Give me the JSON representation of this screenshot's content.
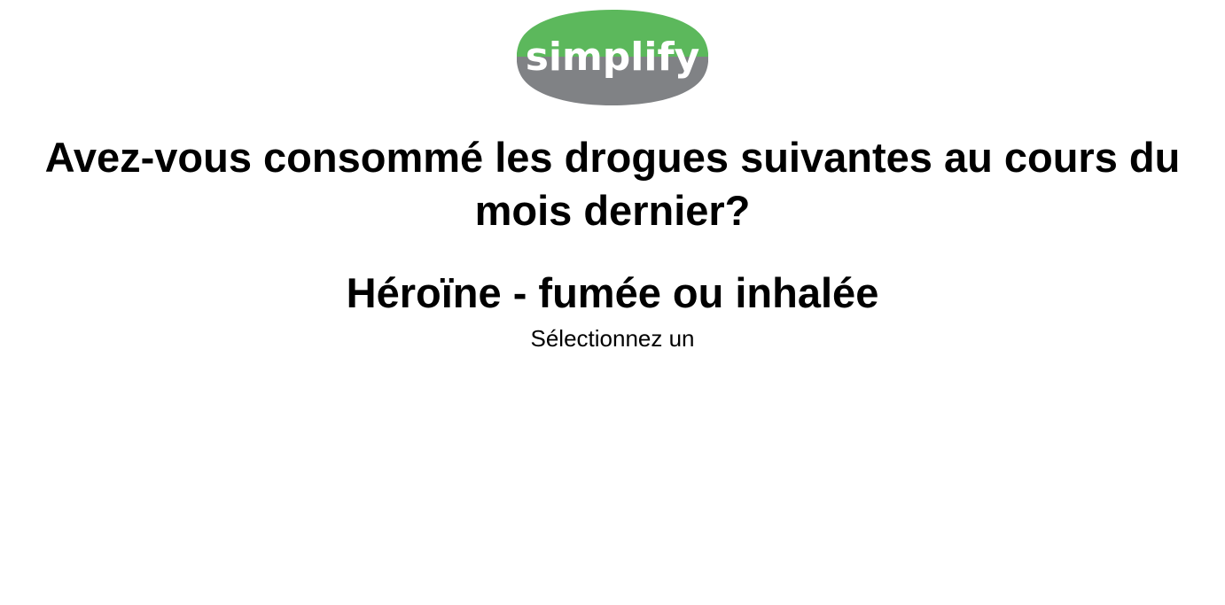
{
  "logo": {
    "text": "simplify",
    "colors": {
      "top": "#5cb85c",
      "bottom": "#808285",
      "text": "#ffffff"
    }
  },
  "survey": {
    "question": "Avez-vous consommé les drogues suivantes au cours du mois dernier?",
    "drug_name": "Héroïne - fumée ou inhalée",
    "instruction": "Sélectionnez un"
  }
}
